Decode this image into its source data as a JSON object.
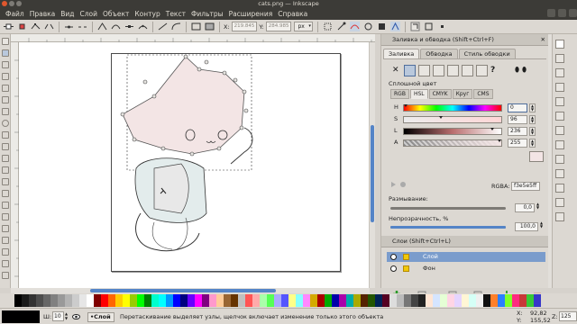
{
  "window": {
    "title": "cats.png — Inkscape"
  },
  "menu": [
    "Файл",
    "Правка",
    "Вид",
    "Слой",
    "Объект",
    "Контур",
    "Текст",
    "Фильтры",
    "Расширения",
    "Справка"
  ],
  "controls": {
    "x": "219.845",
    "y": "284.985",
    "unit": "px"
  },
  "fill_stroke": {
    "title": "Заливка и обводка (Shift+Ctrl+F)",
    "close": "✕",
    "tabs": [
      "Заливка",
      "Обводка",
      "Стиль обводки"
    ],
    "active_tab": "Заливка",
    "paint_mode_label": "Сплошной цвет",
    "color_tabs": [
      "RGB",
      "HSL",
      "CMYK",
      "Круг",
      "CMS"
    ],
    "active_color_tab": "HSL",
    "channels": [
      {
        "label": "H",
        "value": "0",
        "fraction": 0.0
      },
      {
        "label": "S",
        "value": "96",
        "fraction": 0.376
      },
      {
        "label": "L",
        "value": "236",
        "fraction": 0.925
      },
      {
        "label": "A",
        "value": "255",
        "fraction": 1.0
      }
    ],
    "rgba_label": "RGBA:",
    "rgba_value": "f3e5e5ff",
    "blur_label": "Размывание:",
    "blur_value": "0,0",
    "opacity_label": "Непрозрачность, %",
    "opacity_value": "100,0",
    "opacity_fraction": 1.0,
    "color": "#f3e5e5"
  },
  "layers": {
    "title": "Слои (Shift+Ctrl+L)",
    "items": [
      {
        "name": "Слой",
        "selected": true
      },
      {
        "name": "Фон",
        "selected": false
      }
    ]
  },
  "status": {
    "width_label": "Ш:",
    "width_value": "10",
    "layer_indicator": "•Слой",
    "message": "Перетаскивание выделяет узлы, щелчок включает изменение только этого объекта",
    "x_label": "X:",
    "x_value": "92,82",
    "y_label": "Y:",
    "y_value": "155,52",
    "zoom_label": "Z:",
    "zoom_value": "125"
  },
  "palette_colors": [
    "#000000",
    "#1a1a1a",
    "#333333",
    "#4d4d4d",
    "#666666",
    "#808080",
    "#999999",
    "#b3b3b3",
    "#cccccc",
    "#e6e6e6",
    "#ffffff",
    "#800000",
    "#ff0000",
    "#ff6600",
    "#ffcc00",
    "#ffff00",
    "#99cc00",
    "#00ff00",
    "#008000",
    "#00ffcc",
    "#00ffff",
    "#0099ff",
    "#0000ff",
    "#000080",
    "#6600ff",
    "#ff00ff",
    "#800080",
    "#ff99cc",
    "#ffcc99",
    "#996633",
    "#663300",
    "#c0c0c0",
    "#ff5555",
    "#ffaaaa",
    "#aaffaa",
    "#55ff55",
    "#aaaaff",
    "#5555ff",
    "#ffff88",
    "#88ffff",
    "#ff88ff",
    "#d4aa00",
    "#aa0000",
    "#00aa00",
    "#0000aa",
    "#aa00aa",
    "#00aaaa",
    "#aaaa00",
    "#552200",
    "#225500",
    "#002255",
    "#550022",
    "#dddddd",
    "#bbbbbb",
    "#777777",
    "#444444",
    "#222222",
    "#ffe6d5",
    "#d5e5ff",
    "#e5ffd5",
    "#ffd5e5",
    "#e5d5ff",
    "#fff6d5",
    "#d5fff6",
    "#f0f0f0",
    "#101010",
    "#ff7f2a",
    "#2a7fff",
    "#7fff2a",
    "#ff2a7f",
    "#c83737",
    "#37c837",
    "#3737c8"
  ]
}
